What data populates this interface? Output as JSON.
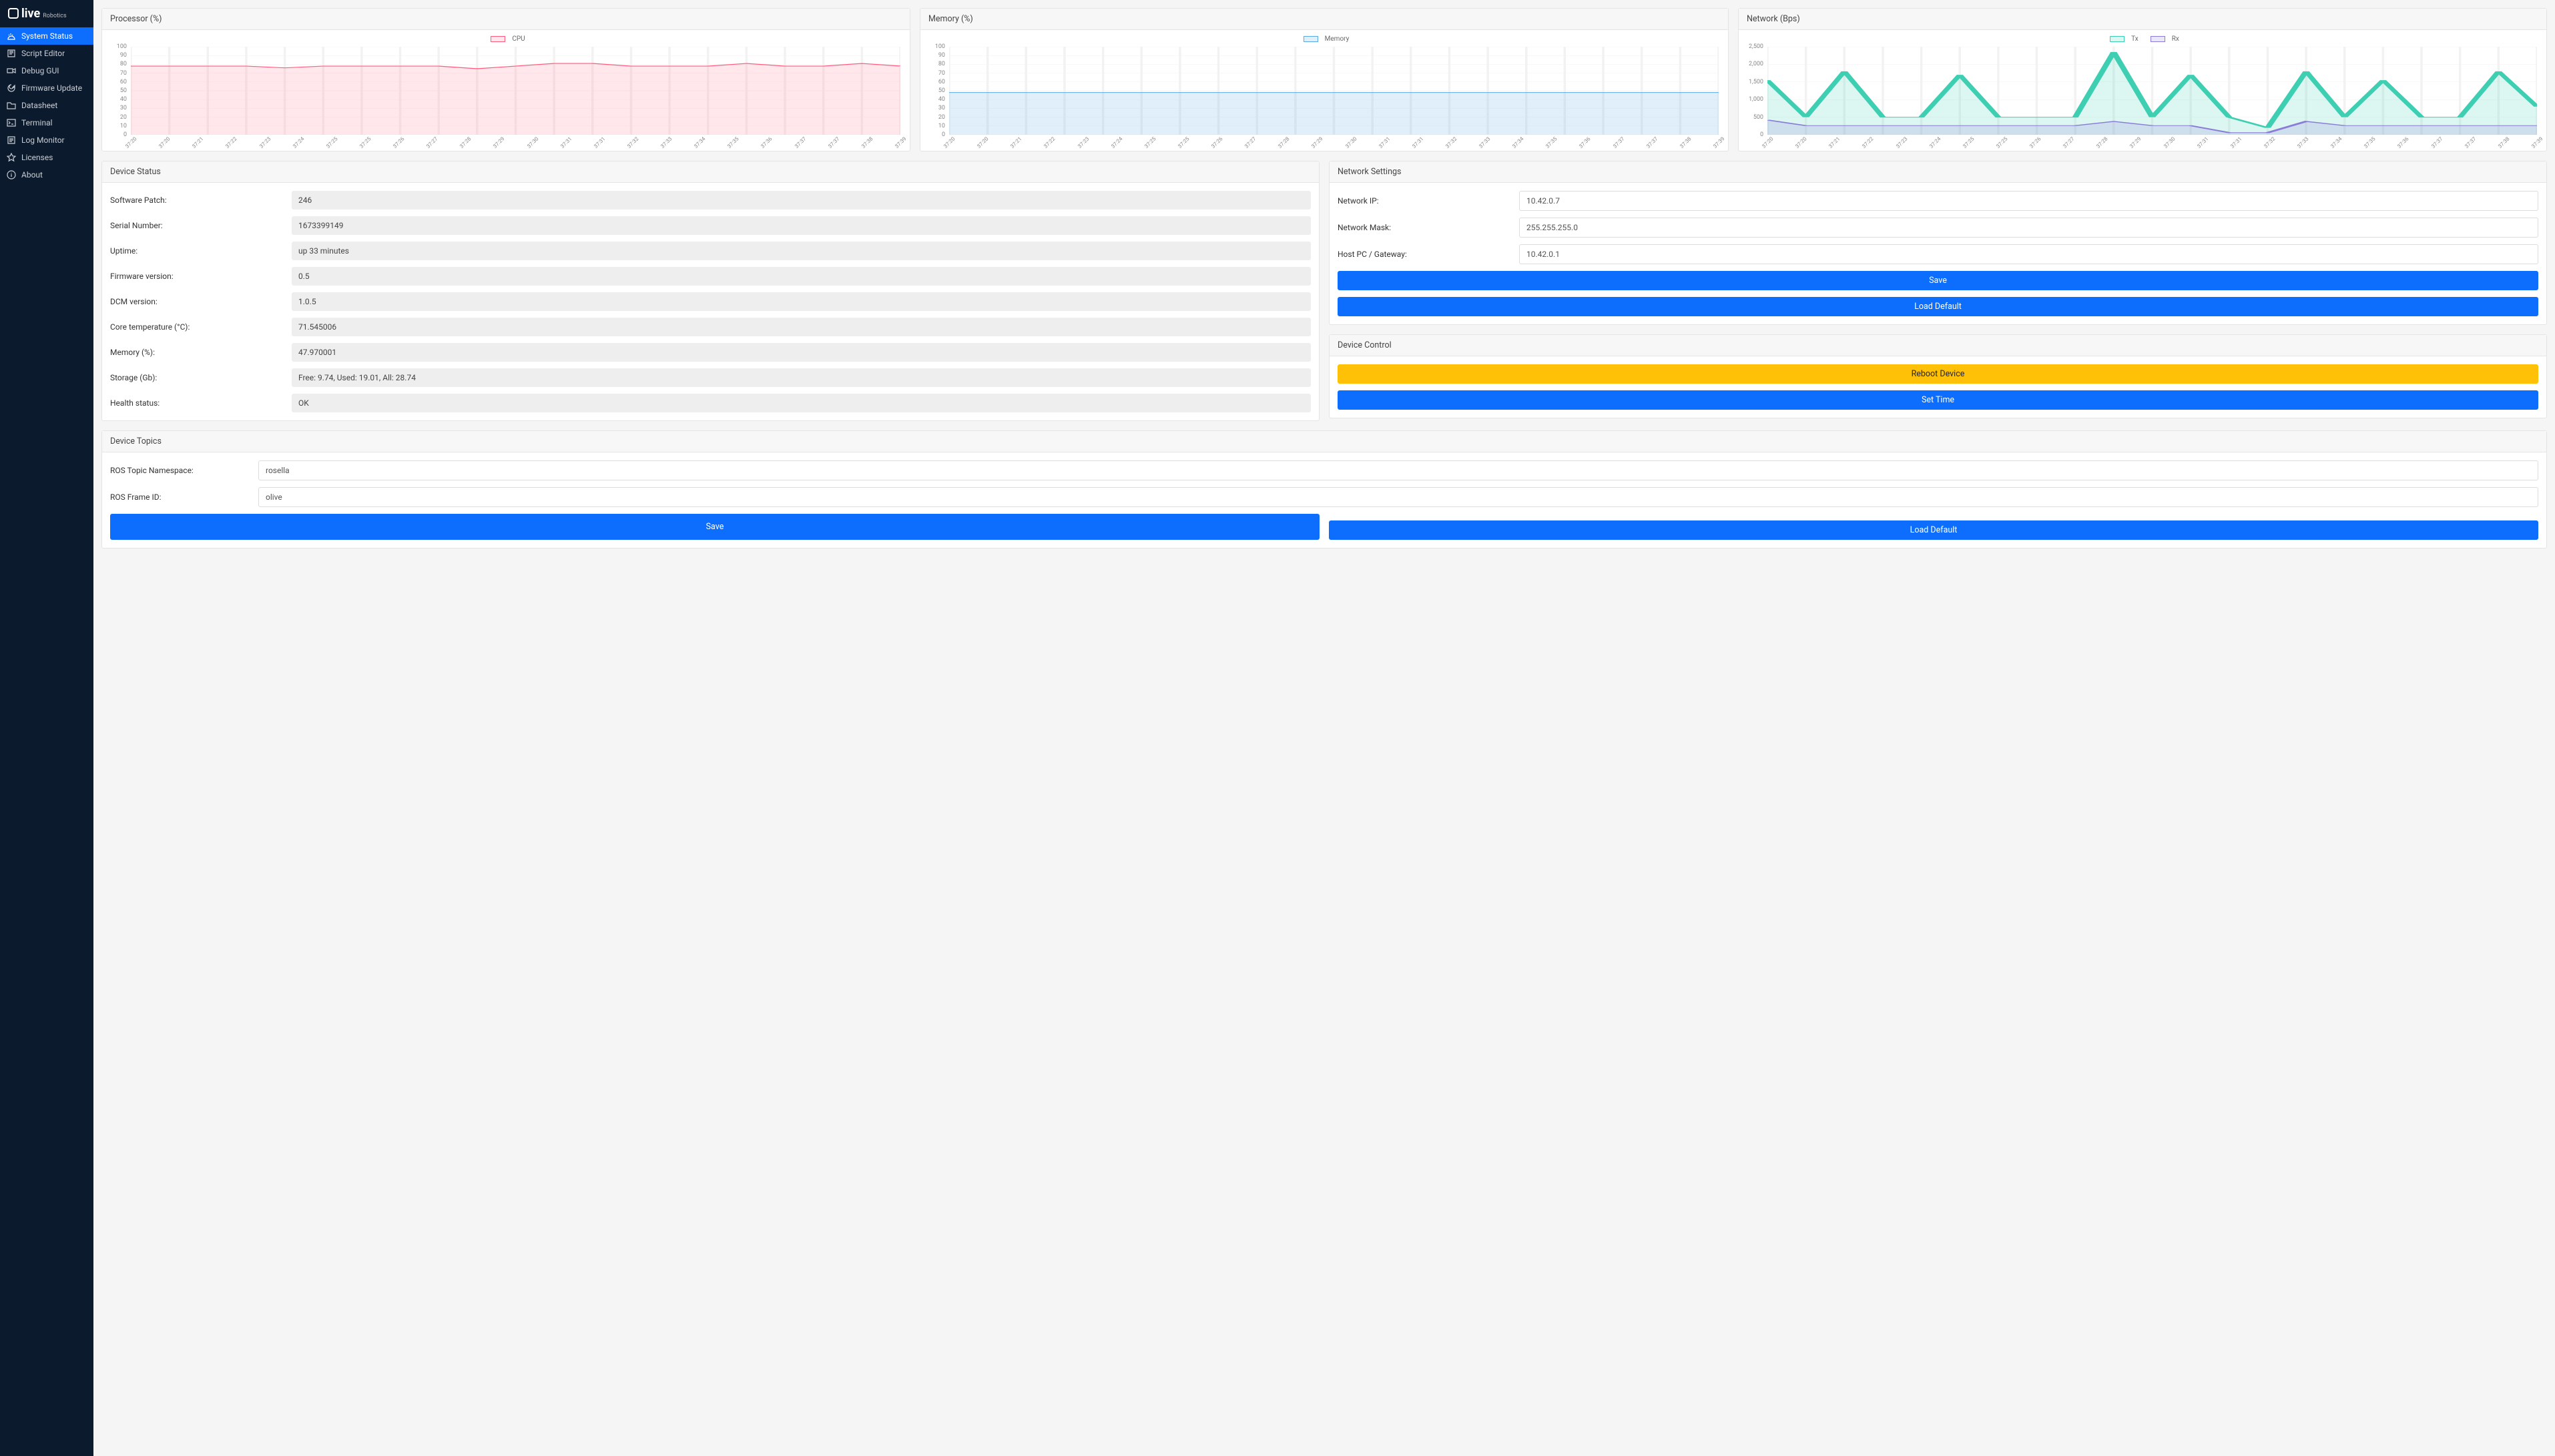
{
  "brand": {
    "name": "live",
    "sub": "Robotics"
  },
  "sidebar": {
    "items": [
      {
        "label": "System Status",
        "icon": "dashboard-icon",
        "active": true
      },
      {
        "label": "Script Editor",
        "icon": "script-icon"
      },
      {
        "label": "Debug GUI",
        "icon": "camera-icon"
      },
      {
        "label": "Firmware Update",
        "icon": "update-icon"
      },
      {
        "label": "Datasheet",
        "icon": "folder-icon"
      },
      {
        "label": "Terminal",
        "icon": "terminal-icon"
      },
      {
        "label": "Log Monitor",
        "icon": "log-icon"
      },
      {
        "label": "Licenses",
        "icon": "star-icon"
      },
      {
        "label": "About",
        "icon": "info-icon"
      }
    ]
  },
  "cards": {
    "processor_title": "Processor (%)",
    "memory_title": "Memory (%)",
    "network_title": "Network (Bps)",
    "device_status_title": "Device Status",
    "network_settings_title": "Network Settings",
    "device_control_title": "Device Control",
    "device_topics_title": "Device Topics"
  },
  "chart_data": [
    {
      "type": "area",
      "title": "Processor (%)",
      "series": [
        {
          "name": "CPU",
          "color": "#ff5b7d",
          "fill": "rgba(255,91,125,0.15)",
          "values": [
            78,
            78,
            78,
            78,
            76,
            78,
            78,
            78,
            78,
            75,
            78,
            81,
            81,
            78,
            78,
            78,
            81,
            78,
            78,
            81,
            78
          ]
        }
      ],
      "categories": [
        "37:20",
        "37:20",
        "37:21",
        "37:22",
        "37:23",
        "37:24",
        "37:25",
        "37:25",
        "37:26",
        "37:27",
        "37:28",
        "37:29",
        "37:30",
        "37:31",
        "37:31",
        "37:32",
        "37:33",
        "37:34",
        "37:35",
        "37:36",
        "37:37",
        "37:37",
        "37:38",
        "37:39"
      ],
      "ylim": [
        0,
        100
      ],
      "yticks": [
        0,
        10,
        20,
        30,
        40,
        50,
        60,
        70,
        80,
        90,
        100
      ],
      "xlabel": "",
      "ylabel": ""
    },
    {
      "type": "area",
      "title": "Memory (%)",
      "series": [
        {
          "name": "Memory",
          "color": "#5aa9e6",
          "fill": "rgba(90,169,230,0.18)",
          "values": [
            48,
            48,
            48,
            48,
            48,
            48,
            48,
            48,
            48,
            48,
            48,
            48,
            48,
            48,
            48,
            48,
            48,
            48,
            48,
            48,
            48
          ]
        }
      ],
      "categories": [
        "37:20",
        "37:20",
        "37:21",
        "37:22",
        "37:23",
        "37:24",
        "37:25",
        "37:25",
        "37:26",
        "37:27",
        "37:28",
        "37:29",
        "37:30",
        "37:31",
        "37:31",
        "37:32",
        "37:33",
        "37:34",
        "37:35",
        "37:36",
        "37:37",
        "37:37",
        "37:38",
        "37:39"
      ],
      "ylim": [
        0,
        100
      ],
      "yticks": [
        0,
        10,
        20,
        30,
        40,
        50,
        60,
        70,
        80,
        90,
        100
      ],
      "xlabel": "",
      "ylabel": ""
    },
    {
      "type": "area",
      "title": "Network (Bps)",
      "series": [
        {
          "name": "Tx",
          "color": "#3ecfb2",
          "fill": "rgba(62,207,178,0.18)",
          "values": [
            1550,
            500,
            1800,
            500,
            500,
            1700,
            500,
            500,
            500,
            2350,
            500,
            1700,
            500,
            200,
            1800,
            500,
            1550,
            500,
            500,
            1800,
            800
          ]
        },
        {
          "name": "Rx",
          "color": "#8b7bd8",
          "fill": "rgba(139,123,216,0.18)",
          "values": [
            420,
            260,
            260,
            260,
            260,
            260,
            260,
            260,
            260,
            380,
            260,
            260,
            60,
            60,
            380,
            260,
            260,
            260,
            260,
            260,
            260
          ]
        }
      ],
      "categories": [
        "37:20",
        "37:20",
        "37:21",
        "37:22",
        "37:23",
        "37:24",
        "37:25",
        "37:25",
        "37:26",
        "37:27",
        "37:28",
        "37:29",
        "37:30",
        "37:31",
        "37:31",
        "37:32",
        "37:33",
        "37:34",
        "37:35",
        "37:36",
        "37:37",
        "37:37",
        "37:38",
        "37:39"
      ],
      "ylim": [
        0,
        2500
      ],
      "yticks": [
        0,
        500,
        1000,
        1500,
        2000,
        2500
      ],
      "xlabel": "",
      "ylabel": ""
    }
  ],
  "device_status": {
    "rows": [
      {
        "label": "Software Patch:",
        "value": "246"
      },
      {
        "label": "Serial Number:",
        "value": "1673399149"
      },
      {
        "label": "Uptime:",
        "value": "up 33 minutes"
      },
      {
        "label": "Firmware version:",
        "value": "0.5"
      },
      {
        "label": "DCM version:",
        "value": "1.0.5"
      },
      {
        "label": "Core temperature (°C):",
        "value": "71.545006"
      },
      {
        "label": "Memory (%):",
        "value": "47.970001"
      },
      {
        "label": "Storage (Gb):",
        "value": "Free: 9.74, Used: 19.01, All: 28.74"
      },
      {
        "label": "Health status:",
        "value": "OK"
      }
    ]
  },
  "network_settings": {
    "ip_label": "Network IP:",
    "ip_value": "10.42.0.7",
    "mask_label": "Network Mask:",
    "mask_value": "255.255.255.0",
    "gateway_label": "Host PC / Gateway:",
    "gateway_value": "10.42.0.1",
    "save_label": "Save",
    "load_default_label": "Load Default"
  },
  "device_control": {
    "reboot_label": "Reboot Device",
    "set_time_label": "Set Time"
  },
  "device_topics": {
    "namespace_label": "ROS Topic Namespace:",
    "namespace_value": "rosella",
    "frame_label": "ROS Frame ID:",
    "frame_value": "olive",
    "save_label": "Save",
    "load_default_label": "Load Default"
  }
}
